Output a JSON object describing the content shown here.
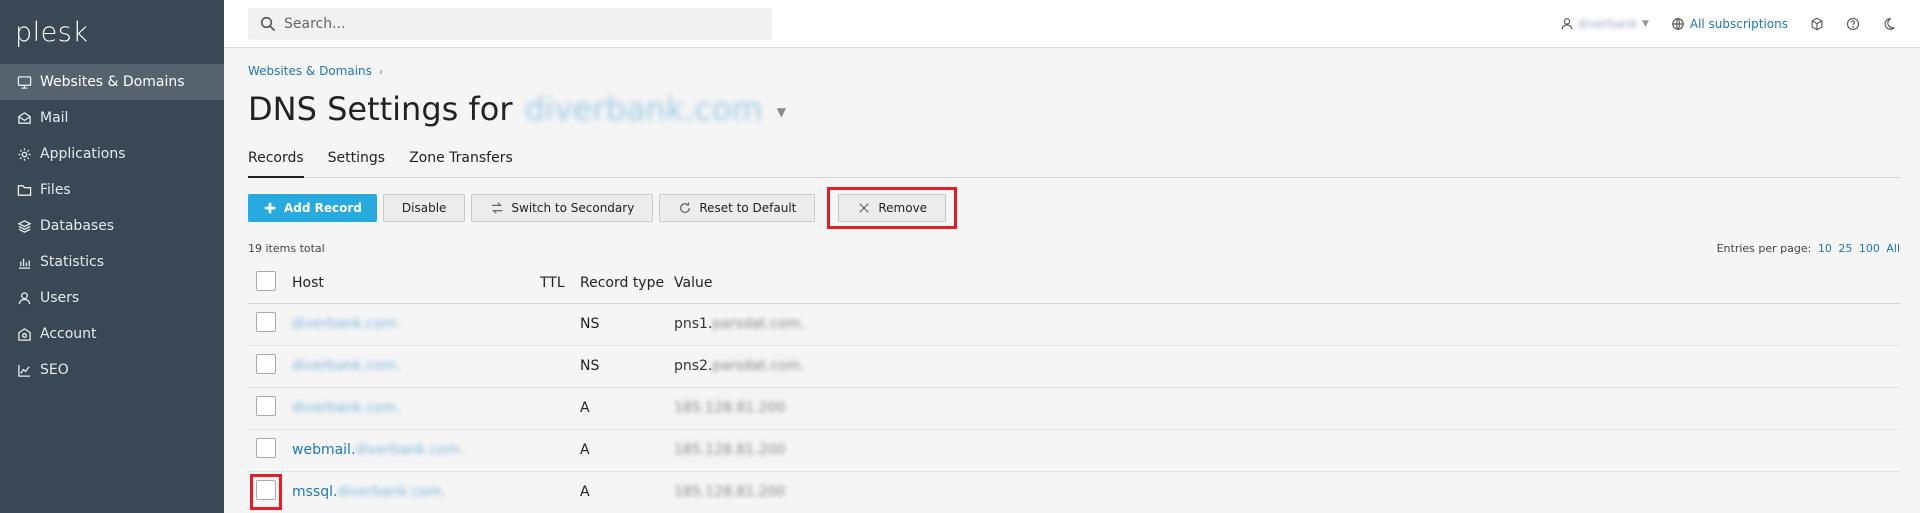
{
  "app": {
    "logo": "plesk"
  },
  "sidebar": {
    "items": [
      {
        "label": "Websites & Domains",
        "icon": "monitor-icon",
        "active": true
      },
      {
        "label": "Mail",
        "icon": "mail-icon",
        "active": false
      },
      {
        "label": "Applications",
        "icon": "gear-icon",
        "active": false
      },
      {
        "label": "Files",
        "icon": "folder-icon",
        "active": false
      },
      {
        "label": "Databases",
        "icon": "layers-icon",
        "active": false
      },
      {
        "label": "Statistics",
        "icon": "bar-chart-icon",
        "active": false
      },
      {
        "label": "Users",
        "icon": "user-icon",
        "active": false
      },
      {
        "label": "Account",
        "icon": "account-icon",
        "active": false
      },
      {
        "label": "SEO",
        "icon": "seo-chart-icon",
        "active": false
      }
    ]
  },
  "topbar": {
    "search_placeholder": "Search...",
    "user_name": "diverbank",
    "subscriptions_label": "All subscriptions"
  },
  "breadcrumb": {
    "item": "Websites & Domains"
  },
  "page": {
    "title_prefix": "DNS Settings for",
    "domain": "diverbank.com"
  },
  "tabs": [
    {
      "label": "Records",
      "active": true
    },
    {
      "label": "Settings",
      "active": false
    },
    {
      "label": "Zone Transfers",
      "active": false
    }
  ],
  "toolbar": {
    "add_record": "Add Record",
    "disable": "Disable",
    "switch_secondary": "Switch to Secondary",
    "reset_default": "Reset to Default",
    "remove": "Remove"
  },
  "list": {
    "total": "19 items total",
    "entries_label": "Entries per page:",
    "entries_options": [
      "10",
      "25",
      "100",
      "All"
    ]
  },
  "table": {
    "headers": {
      "host": "Host",
      "ttl": "TTL",
      "type": "Record type",
      "value": "Value"
    },
    "rows": [
      {
        "host_prefix": "",
        "host": "diverbank.com.",
        "ttl": "",
        "type": "NS",
        "value_prefix": "pns1.",
        "value": "parsdat.com."
      },
      {
        "host_prefix": "",
        "host": "diverbank.com.",
        "ttl": "",
        "type": "NS",
        "value_prefix": "pns2.",
        "value": "parsdat.com."
      },
      {
        "host_prefix": "",
        "host": "diverbank.com.",
        "ttl": "",
        "type": "A",
        "value_prefix": "",
        "value": "185.128.81.200"
      },
      {
        "host_prefix": "webmail.",
        "host": "diverbank.com.",
        "ttl": "",
        "type": "A",
        "value_prefix": "",
        "value": "185.128.81.200"
      },
      {
        "host_prefix": "mssql.",
        "host": "diverbank.com.",
        "ttl": "",
        "type": "A",
        "value_prefix": "",
        "value": "185.128.81.200"
      }
    ]
  }
}
